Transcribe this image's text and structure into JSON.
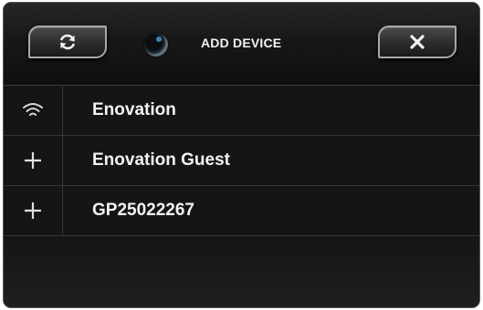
{
  "header": {
    "title": "ADD DEVICE",
    "refresh_icon": "refresh-icon",
    "close_icon": "close-icon",
    "status_icon": "status-orb-icon"
  },
  "networks": [
    {
      "name": "Enovation",
      "icon": "wifi-icon",
      "connected": true
    },
    {
      "name": "Enovation Guest",
      "icon": "plus-icon",
      "connected": false
    },
    {
      "name": "GP25022267",
      "icon": "plus-icon",
      "connected": false
    }
  ],
  "colors": {
    "background": "#151515",
    "text": "#f2f2f2",
    "accent": "#4a97c9"
  }
}
